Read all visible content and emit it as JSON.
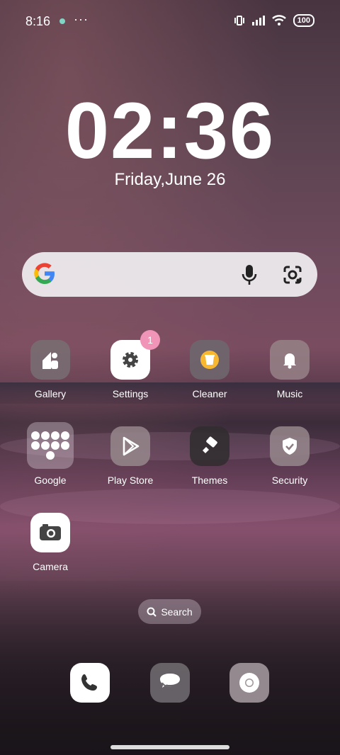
{
  "status_bar": {
    "time": "8:16",
    "more": "···",
    "battery": "100"
  },
  "clock": {
    "time": "02:36",
    "date": "Friday,June 26"
  },
  "apps": [
    {
      "label": "Gallery"
    },
    {
      "label": "Settings",
      "badge": "1"
    },
    {
      "label": "Cleaner"
    },
    {
      "label": "Music"
    },
    {
      "label": "Google"
    },
    {
      "label": "Play Store"
    },
    {
      "label": "Themes"
    },
    {
      "label": "Security"
    },
    {
      "label": "Camera"
    }
  ],
  "search_pill": {
    "label": "Search"
  }
}
